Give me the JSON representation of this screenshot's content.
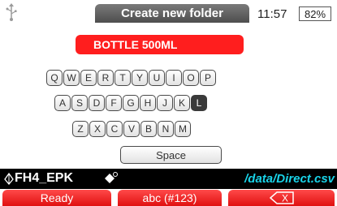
{
  "header": {
    "title": "Create new folder",
    "time": "11:57",
    "battery": "82%"
  },
  "input": {
    "value": "BOTTLE 500ML"
  },
  "keyboard": {
    "row1": [
      "Q",
      "W",
      "E",
      "R",
      "T",
      "Y",
      "U",
      "I",
      "O",
      "P"
    ],
    "row2": [
      "A",
      "S",
      "D",
      "F",
      "G",
      "H",
      "J",
      "K",
      "L"
    ],
    "row3": [
      "Z",
      "X",
      "C",
      "V",
      "B",
      "N",
      "M"
    ],
    "space": "Space",
    "active_key": "L"
  },
  "status": {
    "device": "FH4_EPK",
    "path": "/data/Direct.csv"
  },
  "softkeys": {
    "left": "Ready",
    "middle": "abc (#123)",
    "right": "X"
  },
  "colors": {
    "accent": "#ff1e1e",
    "path": "#19d3e8",
    "title_tab": "#5a5a5a"
  }
}
